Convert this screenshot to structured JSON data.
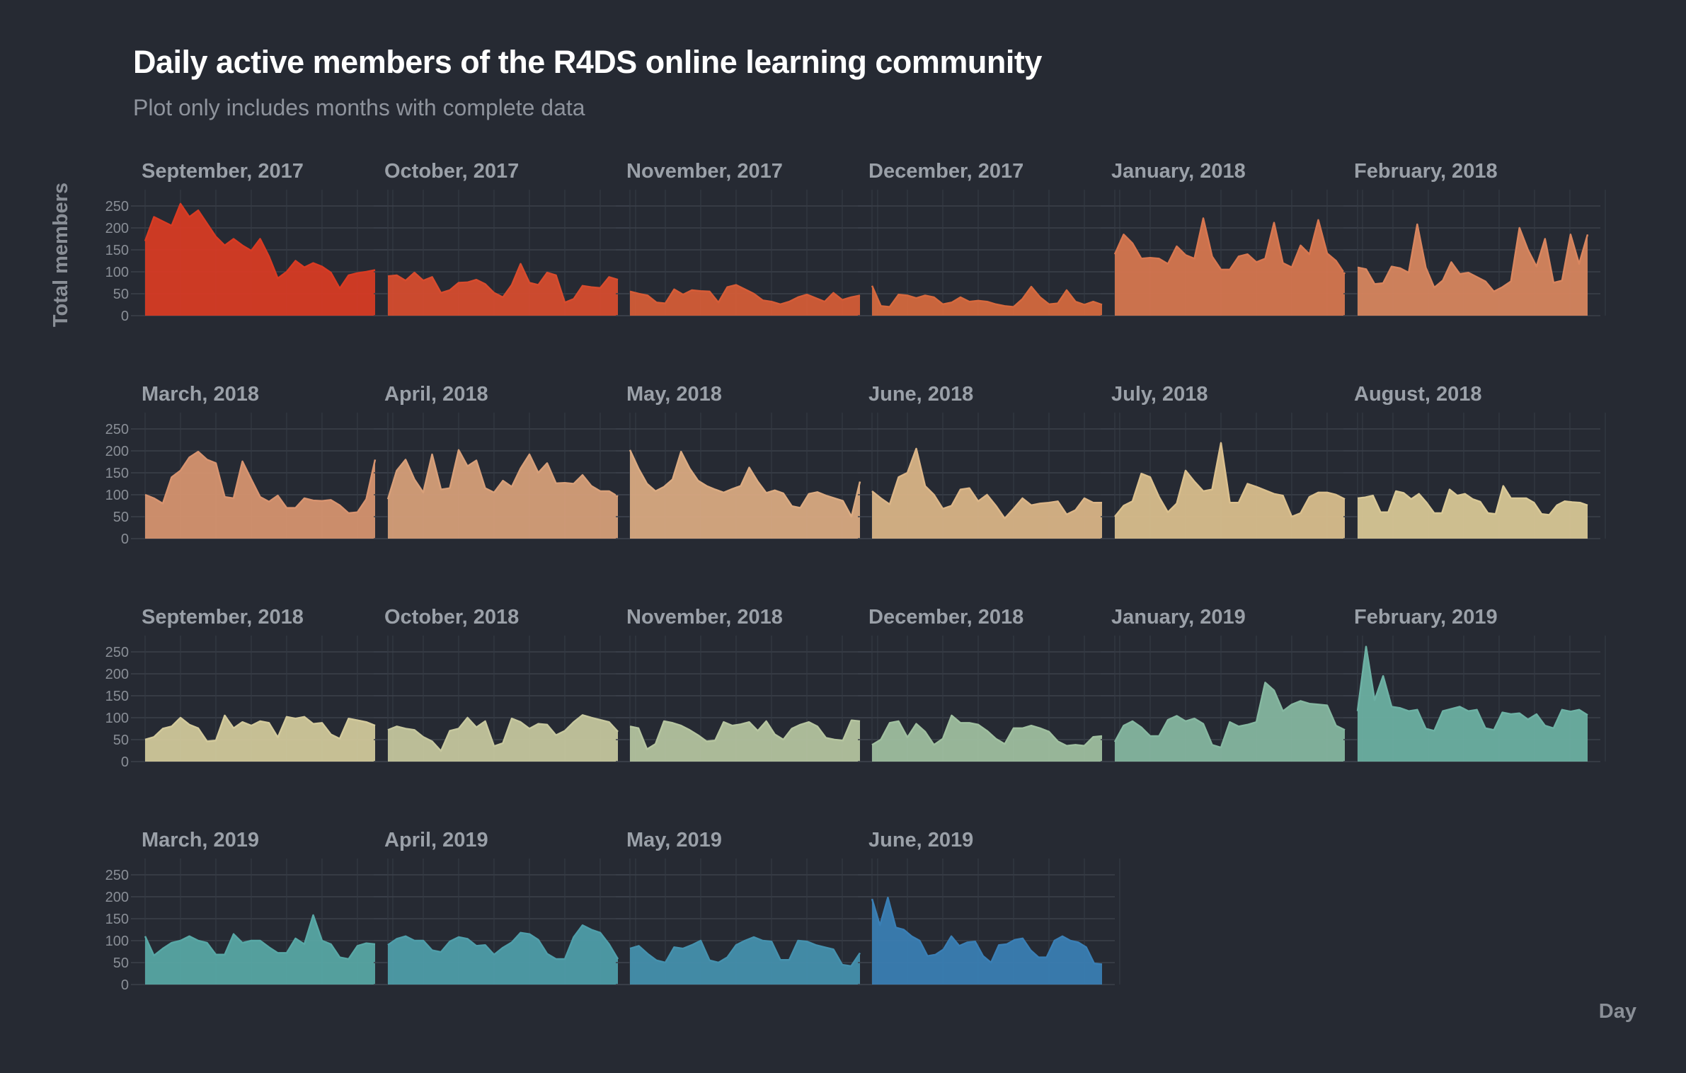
{
  "title": "Daily active members of the R4DS online learning community",
  "subtitle": "Plot only includes months with complete data",
  "chart_data": {
    "type": "area",
    "facet_layout": "6 columns x 4 rows",
    "xlabel": "Day",
    "ylabel": "Total members",
    "ylim": [
      0,
      280
    ],
    "y_ticks": [
      0,
      50,
      100,
      150,
      200,
      250
    ],
    "grid": true,
    "palette_from": "#d93b23",
    "palette_to": "#3a7fb5",
    "series": [
      {
        "name": "September, 2017",
        "color": "#d93b23",
        "values": [
          170,
          225,
          215,
          205,
          255,
          225,
          240,
          210,
          180,
          160,
          175,
          160,
          148,
          175,
          135,
          85,
          100,
          125,
          110,
          120,
          112,
          98,
          62,
          92,
          97,
          100,
          104
        ]
      },
      {
        "name": "October, 2017",
        "color": "#d84c2e",
        "values": [
          90,
          92,
          80,
          98,
          80,
          88,
          52,
          58,
          75,
          76,
          82,
          72,
          52,
          42,
          70,
          118,
          75,
          70,
          98,
          92,
          30,
          38,
          68,
          65,
          63,
          88,
          82
        ]
      },
      {
        "name": "November, 2017",
        "color": "#d65c37",
        "values": [
          55,
          50,
          46,
          30,
          28,
          60,
          48,
          58,
          56,
          55,
          30,
          65,
          70,
          60,
          50,
          35,
          32,
          26,
          32,
          42,
          48,
          40,
          32,
          52,
          36,
          42,
          46
        ]
      },
      {
        "name": "December, 2017",
        "color": "#d6693e",
        "values": [
          68,
          22,
          20,
          48,
          46,
          40,
          46,
          42,
          26,
          30,
          42,
          32,
          34,
          32,
          26,
          22,
          20,
          38,
          66,
          42,
          26,
          28,
          58,
          32,
          25,
          32,
          25
        ]
      },
      {
        "name": "January, 2018",
        "color": "#d87750",
        "values": [
          140,
          185,
          165,
          130,
          132,
          130,
          118,
          158,
          138,
          130,
          222,
          135,
          105,
          105,
          135,
          140,
          122,
          130,
          212,
          120,
          110,
          160,
          140,
          218,
          142,
          125,
          95
        ]
      },
      {
        "name": "February, 2018",
        "color": "#d9865f",
        "values": [
          110,
          106,
          72,
          74,
          112,
          108,
          98,
          208,
          110,
          64,
          80,
          122,
          95,
          98,
          88,
          78,
          55,
          65,
          78,
          200,
          150,
          112,
          175,
          75,
          80,
          185,
          118,
          185
        ]
      },
      {
        "name": "March, 2018",
        "color": "#d89470",
        "values": [
          100,
          92,
          80,
          140,
          155,
          185,
          198,
          180,
          172,
          95,
          92,
          176,
          135,
          95,
          84,
          98,
          70,
          70,
          92,
          87,
          86,
          88,
          76,
          58,
          60,
          90,
          180
        ]
      },
      {
        "name": "April, 2018",
        "color": "#d8a07a",
        "values": [
          90,
          155,
          180,
          135,
          105,
          192,
          112,
          115,
          202,
          165,
          178,
          115,
          105,
          132,
          118,
          160,
          192,
          150,
          172,
          126,
          127,
          125,
          145,
          120,
          108,
          108,
          96
        ]
      },
      {
        "name": "May, 2018",
        "color": "#dbab82",
        "values": [
          202,
          160,
          125,
          108,
          118,
          135,
          198,
          160,
          132,
          120,
          112,
          105,
          113,
          120,
          162,
          130,
          104,
          110,
          103,
          74,
          70,
          102,
          106,
          98,
          92,
          86,
          50,
          130
        ]
      },
      {
        "name": "June, 2018",
        "color": "#dcb688",
        "values": [
          108,
          92,
          78,
          140,
          150,
          205,
          120,
          100,
          68,
          75,
          112,
          115,
          85,
          100,
          75,
          46,
          68,
          92,
          76,
          80,
          82,
          85,
          55,
          65,
          92,
          82,
          82
        ]
      },
      {
        "name": "July, 2018",
        "color": "#dbc08e",
        "values": [
          50,
          75,
          85,
          148,
          140,
          95,
          60,
          80,
          155,
          130,
          108,
          112,
          218,
          82,
          82,
          125,
          118,
          110,
          102,
          98,
          50,
          58,
          95,
          105,
          105,
          100,
          90
        ]
      },
      {
        "name": "August, 2018",
        "color": "#dac997",
        "values": [
          92,
          94,
          98,
          60,
          60,
          108,
          104,
          90,
          102,
          82,
          58,
          58,
          112,
          98,
          102,
          90,
          84,
          58,
          56,
          120,
          92,
          92,
          92,
          82,
          56,
          54,
          76,
          85,
          83,
          82,
          76
        ]
      },
      {
        "name": "September, 2018",
        "color": "#d3ca9c",
        "values": [
          50,
          56,
          75,
          80,
          100,
          84,
          76,
          46,
          48,
          105,
          76,
          90,
          82,
          92,
          88,
          55,
          102,
          98,
          102,
          86,
          88,
          62,
          52,
          98,
          94,
          90,
          82
        ]
      },
      {
        "name": "October, 2018",
        "color": "#c7c89f",
        "values": [
          72,
          80,
          75,
          72,
          56,
          46,
          24,
          70,
          75,
          100,
          78,
          92,
          35,
          42,
          98,
          90,
          75,
          86,
          84,
          60,
          70,
          90,
          106,
          100,
          95,
          90,
          68
        ]
      },
      {
        "name": "November, 2018",
        "color": "#b6c5a0",
        "values": [
          80,
          76,
          28,
          40,
          92,
          88,
          82,
          72,
          60,
          46,
          48,
          90,
          82,
          85,
          90,
          70,
          92,
          62,
          50,
          75,
          84,
          90,
          80,
          54,
          50,
          48,
          94,
          92
        ]
      },
      {
        "name": "December, 2018",
        "color": "#a0c0a0",
        "values": [
          38,
          50,
          88,
          92,
          55,
          86,
          68,
          38,
          52,
          105,
          88,
          88,
          84,
          70,
          52,
          40,
          76,
          76,
          82,
          76,
          68,
          46,
          36,
          38,
          36,
          56,
          58
        ]
      },
      {
        "name": "January, 2019",
        "color": "#86b8a1",
        "values": [
          45,
          82,
          92,
          78,
          58,
          58,
          95,
          104,
          92,
          98,
          86,
          38,
          32,
          90,
          80,
          84,
          90,
          180,
          162,
          115,
          130,
          138,
          132,
          130,
          128,
          82,
          72
        ]
      },
      {
        "name": "February, 2019",
        "color": "#6db1a4",
        "values": [
          115,
          262,
          140,
          195,
          125,
          122,
          115,
          118,
          75,
          70,
          115,
          120,
          125,
          115,
          118,
          76,
          72,
          112,
          108,
          110,
          96,
          108,
          82,
          76,
          118,
          114,
          118,
          106
        ]
      },
      {
        "name": "March, 2019",
        "color": "#58a8a6",
        "values": [
          110,
          66,
          82,
          95,
          100,
          110,
          100,
          95,
          68,
          68,
          115,
          95,
          100,
          100,
          85,
          72,
          72,
          105,
          92,
          158,
          100,
          92,
          62,
          58,
          88,
          94,
          92
        ]
      },
      {
        "name": "April, 2019",
        "color": "#4f9eaa",
        "values": [
          90,
          104,
          110,
          100,
          100,
          78,
          74,
          98,
          108,
          104,
          88,
          90,
          68,
          84,
          96,
          118,
          115,
          102,
          70,
          58,
          58,
          108,
          135,
          125,
          118,
          92,
          58
        ]
      },
      {
        "name": "May, 2019",
        "color": "#4591ae",
        "values": [
          82,
          88,
          70,
          55,
          50,
          85,
          82,
          90,
          100,
          55,
          50,
          62,
          90,
          100,
          108,
          100,
          98,
          56,
          56,
          100,
          98,
          90,
          85,
          80,
          45,
          42,
          72
        ]
      },
      {
        "name": "June, 2019",
        "color": "#3a7fb5",
        "values": [
          195,
          135,
          198,
          130,
          125,
          110,
          100,
          65,
          68,
          80,
          110,
          88,
          96,
          98,
          65,
          50,
          90,
          92,
          102,
          105,
          78,
          62,
          62,
          100,
          110,
          100,
          96,
          85,
          48,
          46
        ]
      }
    ]
  }
}
